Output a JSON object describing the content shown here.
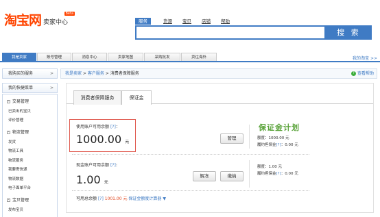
{
  "header": {
    "logo_text": "淘宝网",
    "logo_sub": "卖家中心",
    "beta_label": "Beta",
    "search_tabs": [
      "服务",
      "货源",
      "宝贝",
      "店铺",
      "帮助"
    ],
    "search_button": "搜 索",
    "search_value": ""
  },
  "navbar": {
    "items": [
      "我是卖家",
      "账号管理",
      "消息中心",
      "卖家地图",
      "采购批发",
      "卖往海外"
    ],
    "right_link": "我的淘宝 >>"
  },
  "sidebar": {
    "tab1": "我购买的服务",
    "tab2": "我的快捷菜单",
    "arrow": ">",
    "collapse_glyph": "-",
    "groups": [
      {
        "title": "交易管理",
        "items": [
          "已卖出的宝贝",
          "评价管理"
        ]
      },
      {
        "title": "物流管理",
        "items": [
          "发货",
          "物流工具",
          "物流服务",
          "我要寄快递",
          "物流数据",
          "电子面单平台"
        ]
      },
      {
        "title": "宝贝管理",
        "items": [
          "发布宝贝"
        ]
      }
    ]
  },
  "breadcrumb": {
    "crumb1": "我是卖家",
    "sep": " > ",
    "crumb2": "客户服务",
    "crumb3": "消费者保障服务",
    "help": "查看帮助",
    "help_icon_glyph": "?"
  },
  "tabs": [
    "消费者保障服务",
    "保证金"
  ],
  "account": {
    "label": "使用账户可用余额",
    "q": "[?]",
    "colon": "：",
    "amount": "1000.00",
    "unit": "元",
    "manage_button": "管理",
    "logo_text": "保证金计划",
    "quota_label": "额度：1000.00 元",
    "performance_label": "履约担保金",
    "performance_q": "[?]",
    "performance_value": "：0.00 元"
  },
  "cash": {
    "label": "现金账户可用余额",
    "q": "[?]",
    "colon": ":",
    "amount": "1.00",
    "unit": "元",
    "unfreeze_button": "解冻",
    "pay_button": "缴纳",
    "quota_label": "额度：1.00 元",
    "performance_label": "履约担保金",
    "performance_q": "[?]",
    "performance_value": "：0.00 元"
  },
  "footer": {
    "prefix": "可用总余额",
    "q": "[?]",
    "amount": "1001.00 元",
    "link": "保证金额度计算器",
    "arrow": "▼"
  },
  "colors": {
    "brand": "#ff4400",
    "accent": "#3f7bc4",
    "highlight_box": "#e05a4f",
    "logo_green": "#5aa33a"
  }
}
